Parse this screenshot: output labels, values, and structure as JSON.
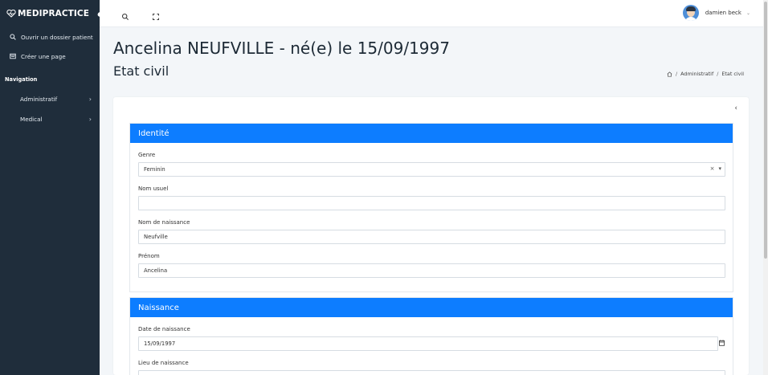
{
  "app": {
    "brand": "MEDIPRACTICE"
  },
  "sidebar": {
    "links": [
      {
        "label": "Ouvrir un dossier patient",
        "icon": "search-icon"
      },
      {
        "label": "Créer une page",
        "icon": "page-icon"
      }
    ],
    "nav_title": "Navigation",
    "items": [
      {
        "label": "Administratif"
      },
      {
        "label": "Medical"
      }
    ]
  },
  "topbar": {
    "user_name": "damien beck"
  },
  "page": {
    "title": "Ancelina NEUFVILLE - né(e) le 15/09/1997",
    "subtitle": "Etat civil",
    "breadcrumb": [
      "Administratif",
      "Etat civil"
    ]
  },
  "identite": {
    "title": "Identité",
    "genre_label": "Genre",
    "genre_value": "Feminin",
    "nom_usuel_label": "Nom usuel",
    "nom_usuel_value": "",
    "nom_naissance_label": "Nom de naissance",
    "nom_naissance_value": "Neufville",
    "prenom_label": "Prénom",
    "prenom_value": "Ancelina"
  },
  "naissance": {
    "title": "Naissance",
    "date_label": "Date de naissance",
    "date_value": "15/09/1997",
    "lieu_label": "Lieu de naissance"
  },
  "colors": {
    "accent": "#0d7dff",
    "sidebar": "#1f2d3b"
  }
}
